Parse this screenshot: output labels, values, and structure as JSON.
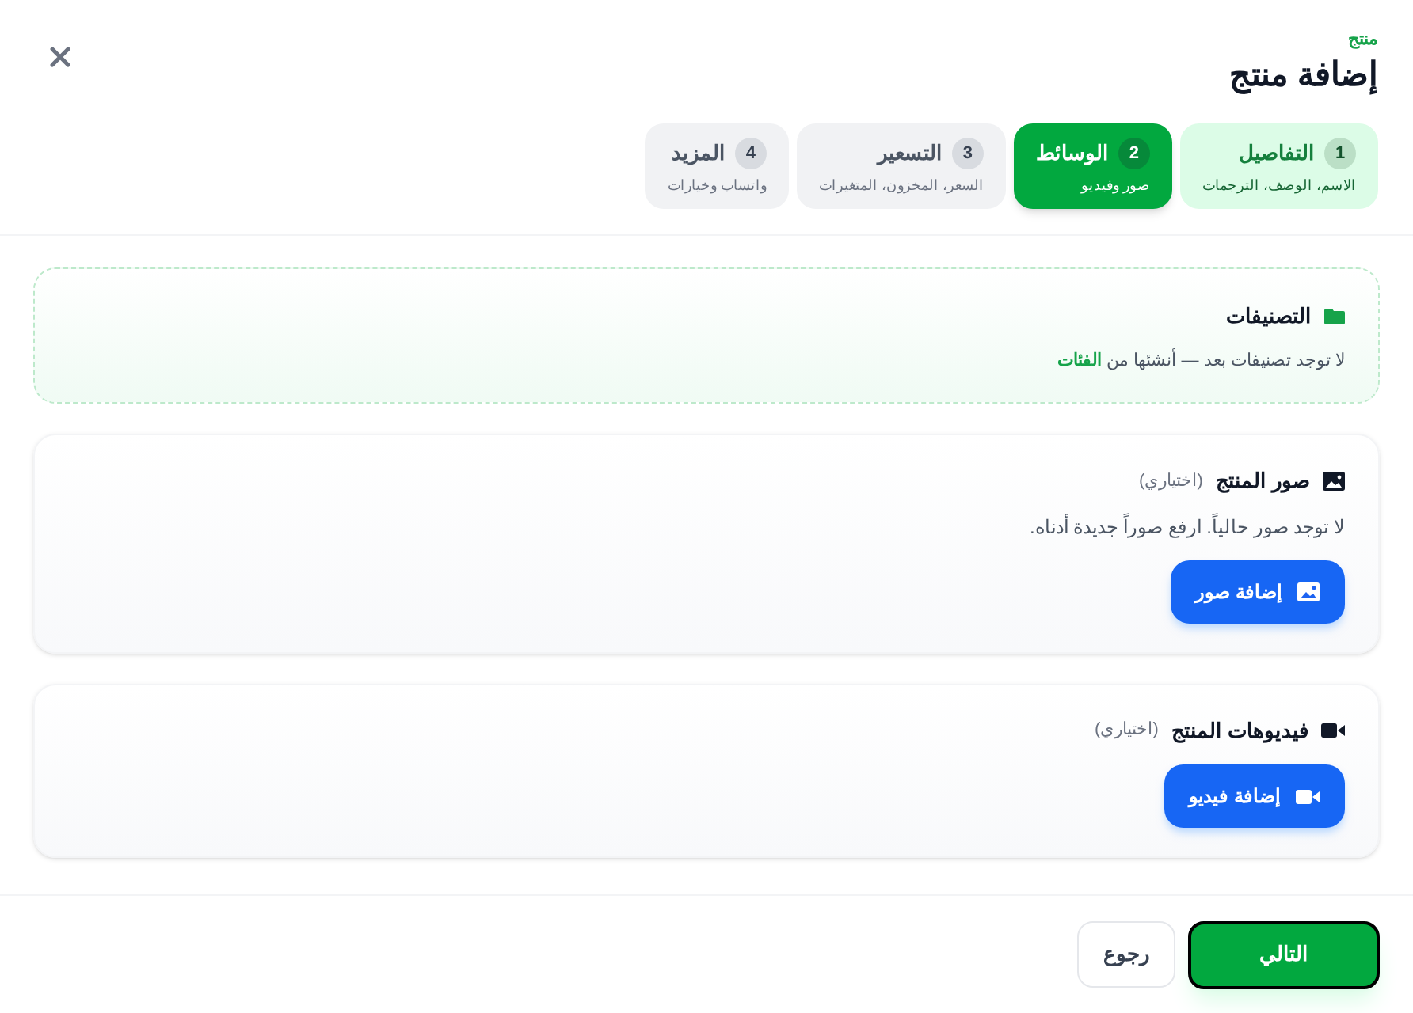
{
  "header": {
    "eyebrow": "منتج",
    "title": "إضافة منتج"
  },
  "steps": [
    {
      "number": "1",
      "title": "التفاصيل",
      "subtitle": "الاسم، الوصف، الترجمات",
      "completed": true,
      "selected": false
    },
    {
      "number": "2",
      "title": "الوسائط",
      "subtitle": "صور وفيديو",
      "completed": false,
      "selected": true
    },
    {
      "number": "3",
      "title": "التسعير",
      "subtitle": "السعر، المخزون، المتغيرات",
      "completed": false,
      "selected": false
    },
    {
      "number": "4",
      "title": "المزيد",
      "subtitle": "واتساب وخيارات",
      "completed": false,
      "selected": false
    }
  ],
  "categories": {
    "title": "التصنيفات",
    "message": "لا توجد تصنيفات بعد — أنشئها من",
    "link": "الفئات"
  },
  "media_sections": [
    {
      "kind": "images",
      "title": "صور المنتج",
      "optional": "(اختياري)",
      "message": "لا توجد صور حالياً. ارفع صوراً جديدة أدناه.",
      "button": "إضافة صور"
    },
    {
      "kind": "videos",
      "title": "فيديوهات المنتج",
      "optional": "(اختياري)",
      "button": "إضافة فيديو"
    }
  ],
  "footer": {
    "next": "التالي",
    "back": "رجوع"
  }
}
